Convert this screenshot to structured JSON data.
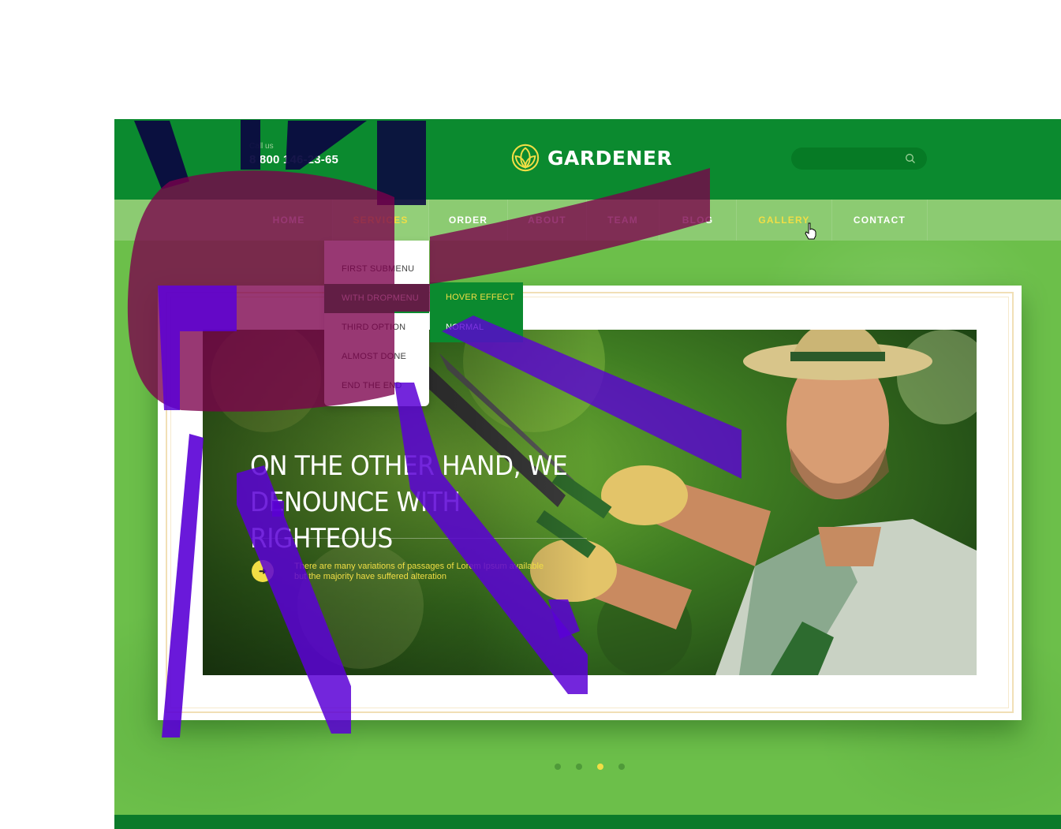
{
  "header": {
    "call_label": "Call us",
    "phone": "8 800 146-23-65",
    "logo_text": "GARDENER",
    "search_placeholder": ""
  },
  "nav": {
    "items": [
      {
        "label": "HOME"
      },
      {
        "label": "SERVICES",
        "state": "active"
      },
      {
        "label": "ORDER"
      },
      {
        "label": "ABOUT"
      },
      {
        "label": "TEAM"
      },
      {
        "label": "BLOG"
      },
      {
        "label": "GALLERY",
        "state": "hover"
      },
      {
        "label": "CONTACT"
      }
    ]
  },
  "dropdown": {
    "items": [
      {
        "label": "FIRST SUBMENU"
      },
      {
        "label": "WITH DROPMENU",
        "state": "active"
      },
      {
        "label": "THIRD OPTION"
      },
      {
        "label": "ALMOST DONE"
      },
      {
        "label": "END THE END"
      }
    ],
    "submenu": [
      {
        "label": "HOVER EFFECT",
        "state": "hover"
      },
      {
        "label": "NORMAL"
      }
    ]
  },
  "hero": {
    "title_line1": "ON THE OTHER HAND, WE",
    "title_line2": "DENOUNCE WITH RIGHTEOUS",
    "button_icon": "arrow-right-icon",
    "desc_line1": "There are many variations of passages of Lorem Ipsum available",
    "desc_line2": "but the majority have suffered alteration"
  },
  "slider": {
    "count": 4,
    "active_index": 2
  },
  "colors": {
    "header_green": "#0b8a2f",
    "page_green": "#6cbf4a",
    "nav_green": "#8ccb72",
    "accent_yellow": "#f1de45",
    "scribble_purple": "#5a00d6",
    "scribble_navy": "#0b0940",
    "scribble_maroon": "#7b004c"
  }
}
